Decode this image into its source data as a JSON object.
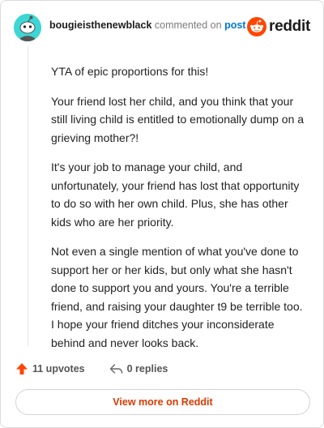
{
  "comment": {
    "username": "bougieisthenewblack",
    "action_text": "commented on",
    "post_link": "post",
    "paragraphs": [
      "YTA of epic proportions for this!",
      "Your friend lost her child, and you think that your still living child is entitled to emotionally dump on a grieving mother?!",
      "It's your job to manage your child, and unfortunately, your friend has lost that opportunity to do so with her own child. Plus, she has other kids who are her priority.",
      "Not even a single mention of what you've done to support her or her kids, but only what she hasn't done to support you and yours. You're a terrible friend, and raising your daughter t9 be terrible too. I hope your friend ditches your inconsiderate behind and never looks back."
    ]
  },
  "brand": {
    "name": "reddit",
    "icon": "reddit-snoo-icon",
    "color": "#ff4500"
  },
  "avatar": {
    "icon": "snoo-avatar-icon",
    "color": "#3ed6d4"
  },
  "actions": {
    "upvotes": "11 upvotes",
    "replies": "0 replies",
    "upvote_icon": "upvote-arrow-icon",
    "reply_icon": "reply-arrow-icon"
  },
  "footer": {
    "view_more": "View more on Reddit"
  },
  "colors": {
    "accent": "#d93a00",
    "link": "#0079d3",
    "upvote": "#ff4500"
  }
}
